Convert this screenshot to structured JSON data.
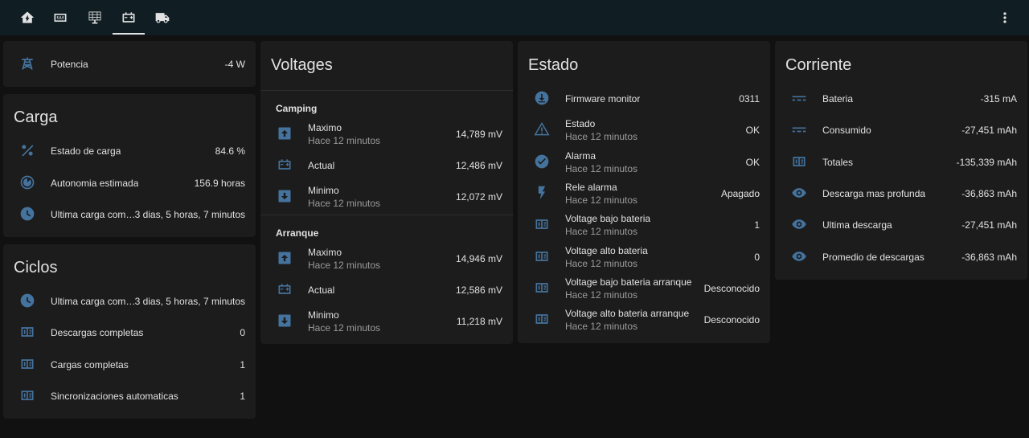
{
  "colors": {
    "icon": "#44739e",
    "bg": "#111111",
    "card": "#1c1c1c",
    "topbar": "#101e24",
    "text": "#e1e1e1",
    "secondary": "#9b9b9b"
  },
  "toolbar": {
    "tabs": [
      {
        "icon": "home-battery-icon"
      },
      {
        "icon": "charger-icon"
      },
      {
        "icon": "solar-panel-icon"
      },
      {
        "icon": "car-battery-icon",
        "active": true
      },
      {
        "icon": "truck-icon"
      }
    ],
    "menu_icon": "dots-vertical-icon"
  },
  "potencia": {
    "label": "Potencia",
    "value": "-4 W",
    "icon": "transmission-tower-icon"
  },
  "carga": {
    "title": "Carga",
    "rows": [
      {
        "label": "Estado de carga",
        "value": "84.6 %",
        "icon": "percent-icon"
      },
      {
        "label": "Autonomia estimada",
        "value": "156.9 horas",
        "icon": "timelapse-icon"
      },
      {
        "label": "Ultima carga completa",
        "value": "3 dias, 5 horas, 7 minutos",
        "icon": "clock-icon"
      }
    ]
  },
  "ciclos": {
    "title": "Ciclos",
    "rows": [
      {
        "label": "Ultima carga completa",
        "value": "3 dias, 5 horas, 7 minutos",
        "icon": "clock-icon"
      },
      {
        "label": "Descargas completas",
        "value": "0",
        "icon": "counter-icon"
      },
      {
        "label": "Cargas completas",
        "value": "1",
        "icon": "counter-icon"
      },
      {
        "label": "Sincronizaciones automaticas",
        "value": "1",
        "icon": "counter-icon"
      }
    ]
  },
  "voltages": {
    "title": "Voltages",
    "groups": [
      {
        "name": "Camping",
        "rows": [
          {
            "label": "Maximo",
            "sub": "Hace 12 minutos",
            "value": "14,789 mV",
            "icon": "arrow-up-box-icon"
          },
          {
            "label": "Actual",
            "value": "12,486 mV",
            "icon": "car-battery-icon"
          },
          {
            "label": "Minimo",
            "sub": "Hace 12 minutos",
            "value": "12,072 mV",
            "icon": "arrow-down-box-icon"
          }
        ]
      },
      {
        "name": "Arranque",
        "rows": [
          {
            "label": "Maximo",
            "sub": "Hace 12 minutos",
            "value": "14,946 mV",
            "icon": "arrow-up-box-icon"
          },
          {
            "label": "Actual",
            "value": "12,586 mV",
            "icon": "car-battery-icon"
          },
          {
            "label": "Minimo",
            "sub": "Hace 12 minutos",
            "value": "11,218 mV",
            "icon": "arrow-down-box-icon"
          }
        ]
      }
    ]
  },
  "estado": {
    "title": "Estado",
    "rows": [
      {
        "label": "Firmware monitor",
        "value": "0311",
        "icon": "download-circle-icon"
      },
      {
        "label": "Estado",
        "sub": "Hace 12 minutos",
        "value": "OK",
        "icon": "alert-icon"
      },
      {
        "label": "Alarma",
        "sub": "Hace 12 minutos",
        "value": "OK",
        "icon": "check-circle-icon"
      },
      {
        "label": "Rele alarma",
        "sub": "Hace 12 minutos",
        "value": "Apagado",
        "icon": "flash-icon"
      },
      {
        "label": "Voltage bajo bateria",
        "sub": "Hace 12 minutos",
        "value": "1",
        "icon": "counter-icon"
      },
      {
        "label": "Voltage alto bateria",
        "sub": "Hace 12 minutos",
        "value": "0",
        "icon": "counter-icon"
      },
      {
        "label": "Voltage bajo bateria arranque",
        "sub": "Hace 12 minutos",
        "value": "Desconocido",
        "icon": "counter-icon"
      },
      {
        "label": "Voltage alto bateria arranque",
        "sub": "Hace 12 minutos",
        "value": "Desconocido",
        "icon": "counter-icon"
      }
    ]
  },
  "corriente": {
    "title": "Corriente",
    "rows": [
      {
        "label": "Bateria",
        "value": "-315 mA",
        "icon": "current-dc-icon"
      },
      {
        "label": "Consumido",
        "value": "-27,451 mAh",
        "icon": "current-dc-icon"
      },
      {
        "label": "Totales",
        "value": "-135,339 mAh",
        "icon": "counter-icon"
      },
      {
        "label": "Descarga mas profunda",
        "value": "-36,863 mAh",
        "icon": "eye-icon"
      },
      {
        "label": "Ultima descarga",
        "value": "-27,451 mAh",
        "icon": "eye-icon"
      },
      {
        "label": "Promedio de descargas",
        "value": "-36,863 mAh",
        "icon": "eye-icon"
      }
    ]
  }
}
